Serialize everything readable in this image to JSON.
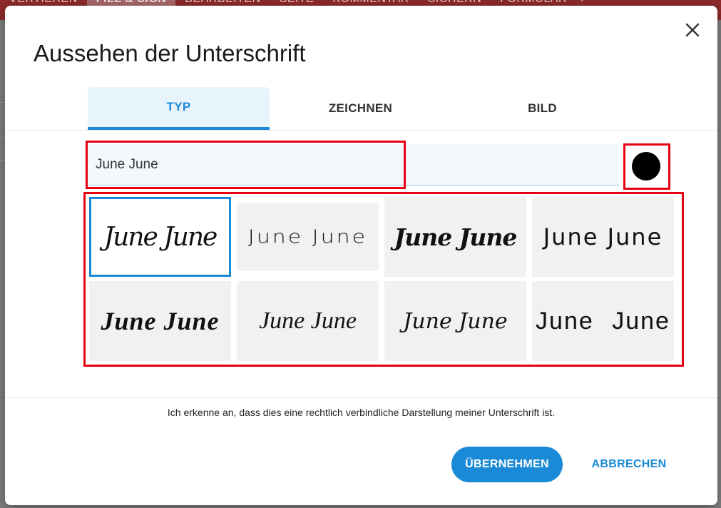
{
  "background": {
    "toolbar_tabs": [
      "VERTIEREN",
      "FILL & SIGN",
      "BEARBEITEN",
      "SEITE",
      "KOMMENTAR",
      "SICHERN",
      "FORMULAR"
    ],
    "active_tab_index": 1
  },
  "dialog": {
    "title": "Aussehen der Unterschrift",
    "tabs": [
      {
        "label": "TYP",
        "active": true
      },
      {
        "label": "ZEICHNEN",
        "active": false
      },
      {
        "label": "BILD",
        "active": false
      }
    ],
    "name_input": {
      "value": "June June"
    },
    "ink_color": "#000000",
    "signature_samples": [
      {
        "text": "June June",
        "selected": true
      },
      {
        "text": "June June",
        "selected": false
      },
      {
        "text": "June June",
        "selected": false
      },
      {
        "text": "June June",
        "selected": false
      },
      {
        "text": "June June",
        "selected": false
      },
      {
        "text": "June June",
        "selected": false
      },
      {
        "text": "June June",
        "selected": false
      },
      {
        "text": "June June",
        "selected": false
      }
    ],
    "legal_notice": "Ich erkenne an, dass dies eine rechtlich verbindliche Darstellung meiner Unterschrift ist.",
    "apply_label": "ÜBERNEHMEN",
    "cancel_label": "ABBRECHEN"
  },
  "colors": {
    "accent": "#1a8ad6",
    "highlight": "#e60012"
  }
}
